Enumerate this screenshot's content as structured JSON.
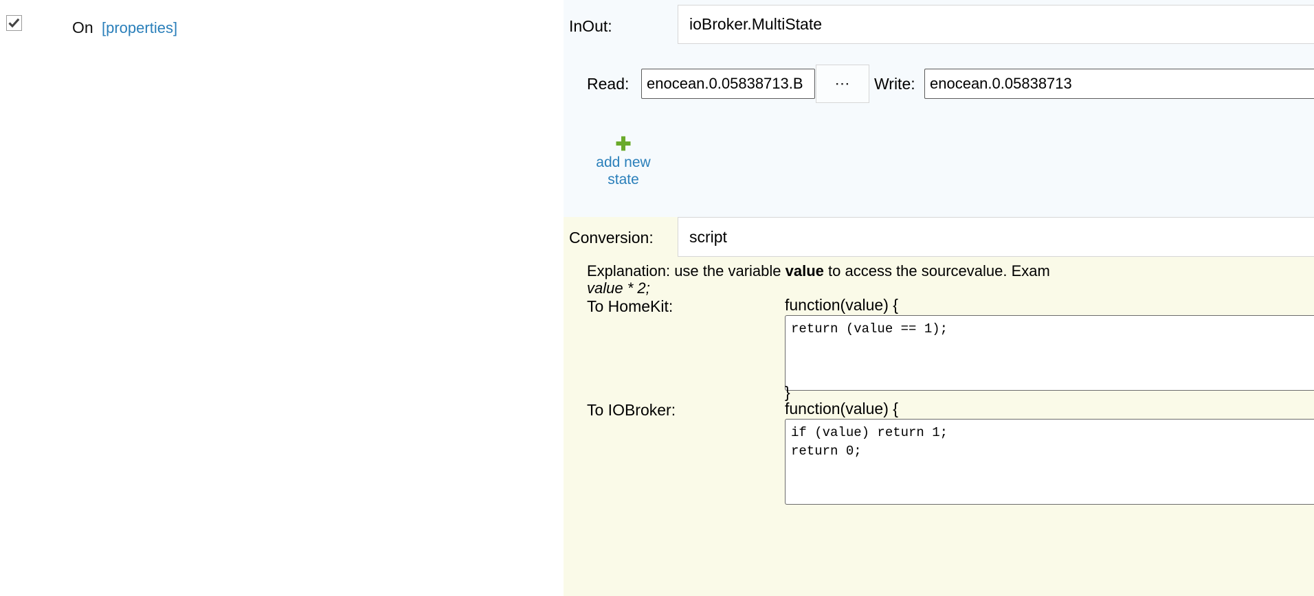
{
  "device": {
    "enabled": true,
    "checkbox_icon": "checkmark-icon",
    "name": "On",
    "properties_link": "[properties]"
  },
  "panel": {
    "inout": {
      "label": "InOut:",
      "value": "ioBroker.MultiState"
    },
    "read": {
      "label": "Read:",
      "value": "enocean.0.05838713.B"
    },
    "browse_button": {
      "label": "⋯",
      "icon": "ellipsis-icon"
    },
    "write": {
      "label": "Write:",
      "value": "enocean.0.05838713"
    },
    "add_new_state": {
      "icon": "plus-icon",
      "icon_color": "#6aaa2a",
      "label": "add new state"
    },
    "conversion": {
      "label": "Conversion:",
      "value": "script",
      "explanation_prefix": "Explanation: use the variable ",
      "explanation_bold": "value",
      "explanation_suffix": " to access the sourcevalue. Exam",
      "explanation_example": "value * 2;",
      "to_homekit": {
        "label": "To HomeKit:",
        "function_open": "function(value) {",
        "code": "return (value == 1);",
        "function_close": "}"
      },
      "to_iobroker": {
        "label": "To IOBroker:",
        "function_open": "function(value) {",
        "code": "if (value) return 1;\nreturn 0;"
      }
    }
  },
  "colors": {
    "link": "#2a7fba",
    "panel_blue": "#f6fafd",
    "panel_cream": "#fafae8",
    "plus_green": "#6aaa2a"
  }
}
